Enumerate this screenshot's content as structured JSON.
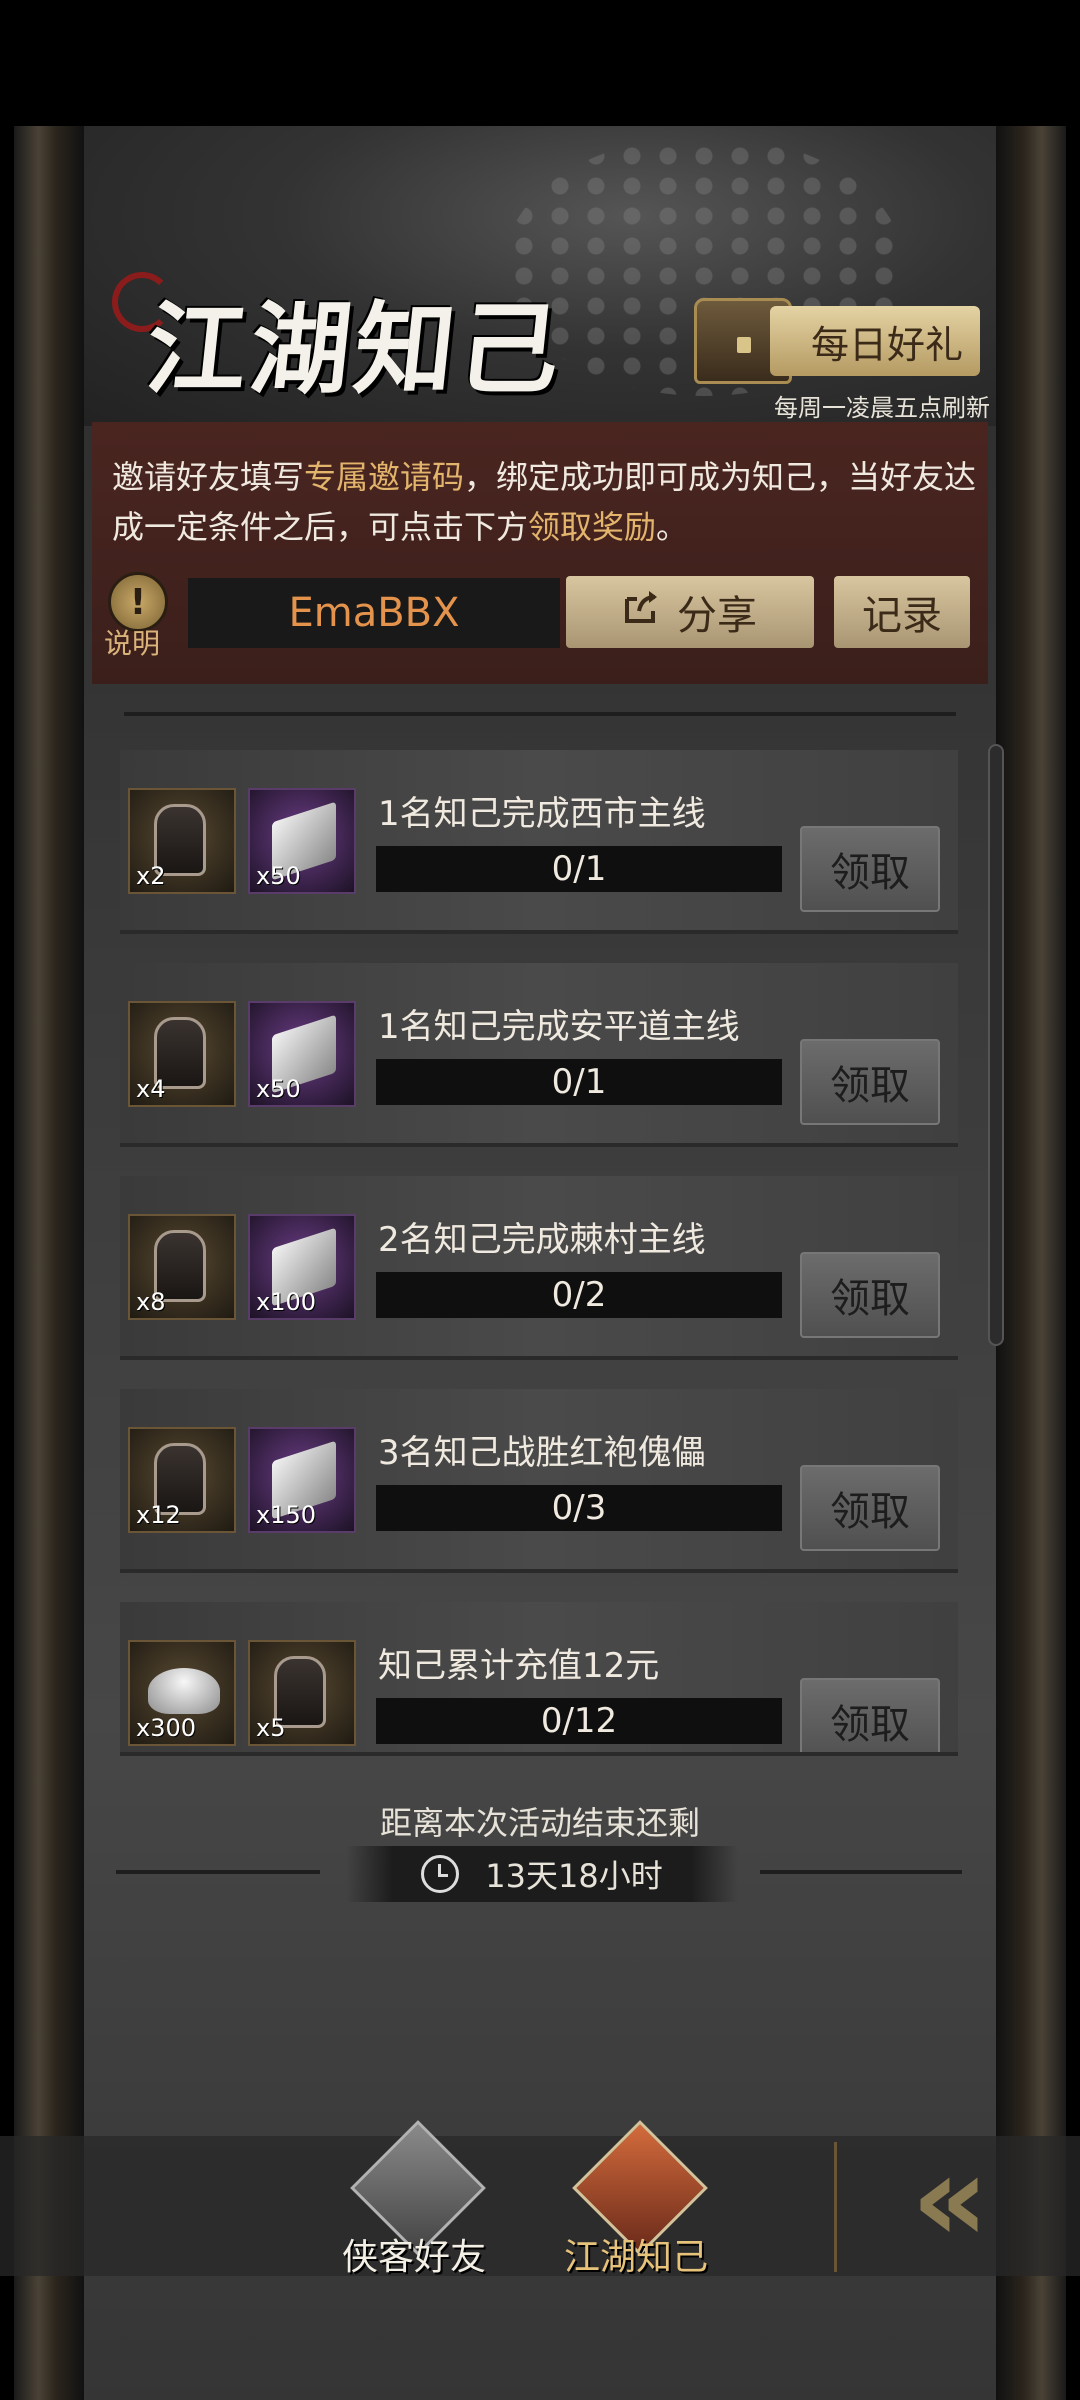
{
  "header": {
    "title": "江湖知己",
    "daily_gift_label": "每日好礼",
    "daily_refresh_note": "每周一凌晨五点刷新"
  },
  "description": {
    "part1": "邀请好友填写",
    "highlight1": "专属邀请码",
    "part2": "，绑定成功即可成为知己，当好友达成一定条件之后，可点击下方",
    "highlight2": "领取奖励",
    "part3": "。"
  },
  "invite": {
    "info_label": "说明",
    "code": "EmaBBX",
    "share_label": "分享",
    "record_label": "记录"
  },
  "tasks": [
    {
      "title": "1名知己完成西市主线",
      "progress": "0/1",
      "claim": "领取",
      "rewards": [
        {
          "type": "token",
          "qty": "x2"
        },
        {
          "type": "silver",
          "qty": "x50"
        }
      ]
    },
    {
      "title": "1名知己完成安平道主线",
      "progress": "0/1",
      "claim": "领取",
      "rewards": [
        {
          "type": "token",
          "qty": "x4"
        },
        {
          "type": "silver",
          "qty": "x50"
        }
      ]
    },
    {
      "title": "2名知己完成棘村主线",
      "progress": "0/2",
      "claim": "领取",
      "rewards": [
        {
          "type": "token",
          "qty": "x8"
        },
        {
          "type": "silver",
          "qty": "x100"
        }
      ]
    },
    {
      "title": "3名知己战胜红袍傀儡",
      "progress": "0/3",
      "claim": "领取",
      "rewards": [
        {
          "type": "token",
          "qty": "x12"
        },
        {
          "type": "silver",
          "qty": "x150"
        }
      ]
    },
    {
      "title": "知己累计充值12元",
      "progress": "0/12",
      "claim": "领取",
      "rewards": [
        {
          "type": "ingot",
          "qty": "x300"
        },
        {
          "type": "token",
          "qty": "x5"
        }
      ]
    }
  ],
  "countdown": {
    "label": "距离本次活动结束还剩",
    "value": "13天18小时"
  },
  "bottom_nav": [
    {
      "label": "侠客好友",
      "active": false
    },
    {
      "label": "江湖知己",
      "active": true
    }
  ]
}
